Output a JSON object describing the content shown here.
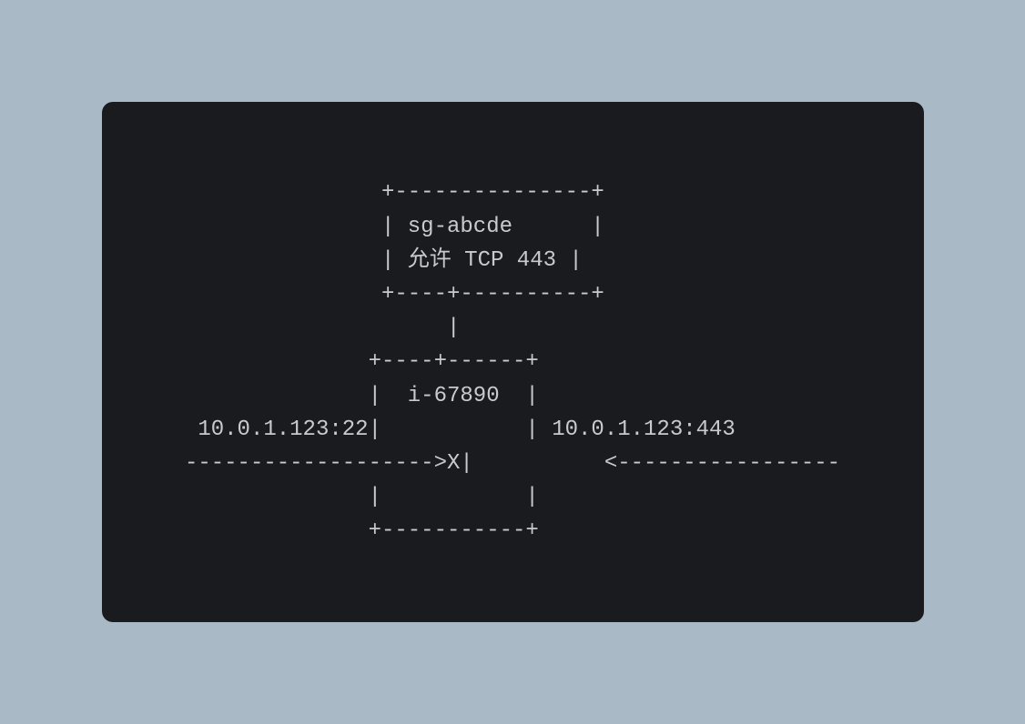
{
  "diagram": {
    "security_group": {
      "id": "sg-abcde",
      "rule": "允许 TCP 443"
    },
    "instance": {
      "id": "i-67890"
    },
    "connections": {
      "left": {
        "address": "10.0.1.123:22",
        "blocked": true
      },
      "right": {
        "address": "10.0.1.123:443",
        "blocked": false
      }
    },
    "ascii": "               +---------------+\n               | sg-abcde      |\n               | 允许 TCP 443 |\n               +----+----------+\n                    |\n              +----+------+\n              |  i-67890  |\n 10.0.1.123:22|           | 10.0.1.123:443\n------------------->X|          <-----------------\n              |           |\n              +-----------+"
  }
}
